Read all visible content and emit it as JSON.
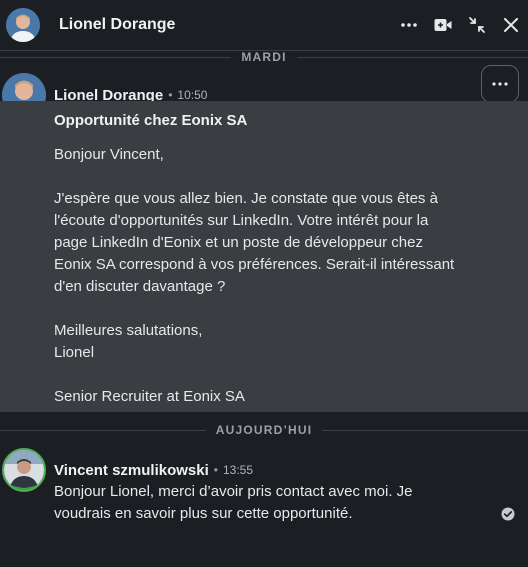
{
  "header": {
    "contact_name": "Lionel Dorange",
    "actions": [
      "more-options",
      "video-call",
      "minimize",
      "close"
    ]
  },
  "dividers": {
    "first": "MARDI",
    "second": "AUJOURD’HUI"
  },
  "messages": [
    {
      "sender": "Lionel Dorange",
      "time": "10:50",
      "subject": "Opportunité chez Eonix SA",
      "paragraphs": [
        "Bonjour Vincent,",
        "J'espère que vous allez bien. Je constate que vous êtes à\nl'écoute d'opportunités sur LinkedIn. Votre intérêt pour la\npage LinkedIn d'Eonix et un poste de développeur chez\nEonix SA correspond à vos préférences. Serait-il intéressant\nd'en discuter davantage ?",
        "Meilleures salutations,\nLionel",
        "Senior Recruiter at Eonix SA"
      ]
    },
    {
      "sender": "Vincent szmulikowski",
      "time": "13:55",
      "text": "Bonjour Lionel, merci d’avoir pris contact avec moi. Je\nvoudrais en savoir plus sur cette opportunité."
    }
  ],
  "colors": {
    "background": "#1b1f23",
    "highlight": "#3a3d41",
    "divider": "#3a3f44",
    "text": "#e8e8e8",
    "muted": "#9aa0a6"
  }
}
